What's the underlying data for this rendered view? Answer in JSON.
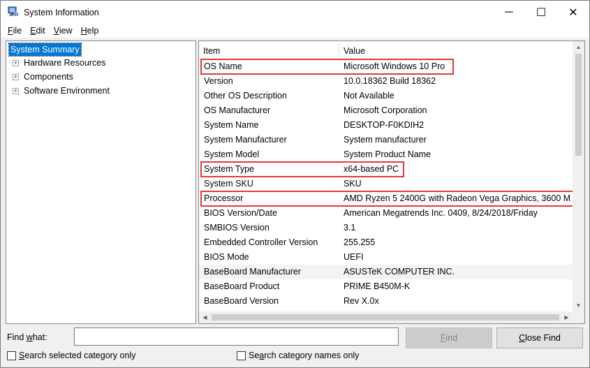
{
  "window": {
    "title": "System Information",
    "icon": "system-info-icon",
    "controls": {
      "minimize": "─",
      "maximize": "☐",
      "close": "✕"
    }
  },
  "menu": [
    {
      "label": "File",
      "accel": "F",
      "rest": "ile"
    },
    {
      "label": "Edit",
      "accel": "E",
      "rest": "dit"
    },
    {
      "label": "View",
      "accel": "V",
      "rest": "iew"
    },
    {
      "label": "Help",
      "accel": "H",
      "rest": "elp"
    }
  ],
  "tree": {
    "root": "System Summary",
    "children": [
      "Hardware Resources",
      "Components",
      "Software Environment"
    ],
    "expander": "+"
  },
  "table": {
    "columns": [
      "Item",
      "Value"
    ],
    "rows": [
      {
        "item": "OS Name",
        "value": "Microsoft Windows 10 Pro",
        "highlighted": true
      },
      {
        "item": "Version",
        "value": "10.0.18362 Build 18362"
      },
      {
        "item": "Other OS Description",
        "value": "Not Available"
      },
      {
        "item": "OS Manufacturer",
        "value": "Microsoft Corporation"
      },
      {
        "item": "System Name",
        "value": "DESKTOP-F0KDIH2"
      },
      {
        "item": "System Manufacturer",
        "value": "System manufacturer"
      },
      {
        "item": "System Model",
        "value": "System Product Name"
      },
      {
        "item": "System Type",
        "value": "x64-based PC",
        "highlighted": true
      },
      {
        "item": "System SKU",
        "value": "SKU"
      },
      {
        "item": "Processor",
        "value": "AMD Ryzen 5 2400G with Radeon Vega Graphics, 3600 M",
        "highlighted": true
      },
      {
        "item": "BIOS Version/Date",
        "value": "American Megatrends Inc. 0409, 8/24/2018/Friday"
      },
      {
        "item": "SMBIOS Version",
        "value": "3.1"
      },
      {
        "item": "Embedded Controller Version",
        "value": "255.255"
      },
      {
        "item": "BIOS Mode",
        "value": "UEFI"
      },
      {
        "item": "BaseBoard Manufacturer",
        "value": "ASUSTeK COMPUTER INC."
      },
      {
        "item": "BaseBoard Product",
        "value": "PRIME B450M-K"
      },
      {
        "item": "BaseBoard Version",
        "value": "Rev X.0x"
      }
    ],
    "highlight_color": "#e53935"
  },
  "find": {
    "label_pre": "Find ",
    "label_accel": "w",
    "label_post": "hat:",
    "input_value": "",
    "find_button": {
      "accel": "F",
      "rest": "ind"
    },
    "close_find_button": {
      "accel": "C",
      "rest": "lose Find"
    },
    "search_selected": {
      "accel": "S",
      "rest": "earch selected category only"
    },
    "search_names": {
      "pre": "Se",
      "accel": "a",
      "rest": "rch category names only"
    }
  },
  "scroll": {
    "up": "▲",
    "down": "▼",
    "left": "◀",
    "right": "▶"
  },
  "selection_color": "#0078d7"
}
